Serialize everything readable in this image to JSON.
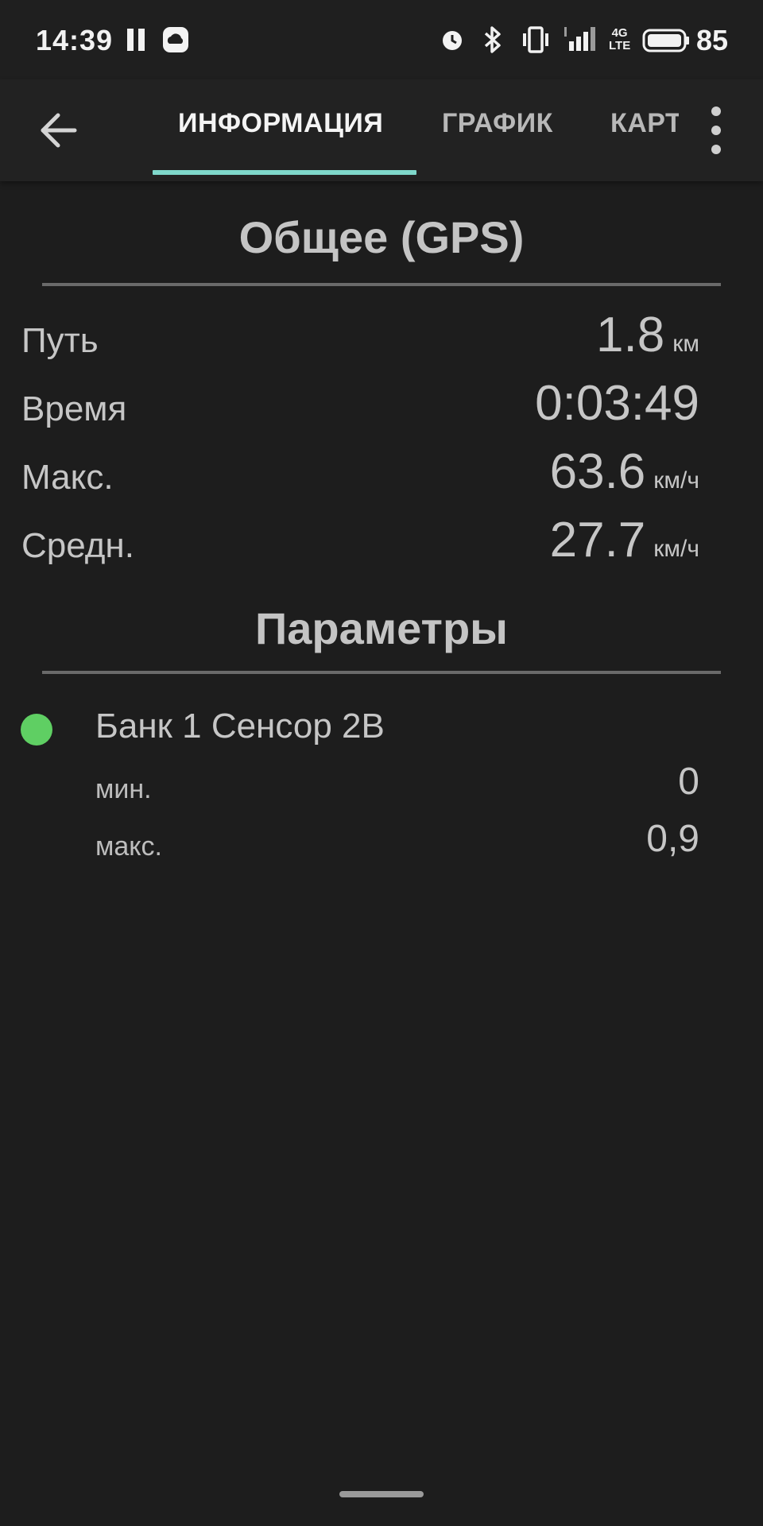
{
  "status_bar": {
    "time": "14:39",
    "network_label_top": "4G",
    "network_label_bottom": "LTE",
    "battery_level": "85",
    "icons": [
      "pause-icon",
      "cloud-app-icon",
      "alarm-icon",
      "bluetooth-icon",
      "vibrate-icon",
      "signal-icon",
      "network-4g-lte-icon",
      "battery-icon"
    ]
  },
  "toolbar": {
    "back_icon": "arrow-left-icon",
    "tabs": [
      {
        "label": "ИНФОРМАЦИЯ",
        "active": true
      },
      {
        "label": "ГРАФИК",
        "active": false
      },
      {
        "label": "КАРТА",
        "active": false
      }
    ],
    "overflow_icon": "more-vert-icon",
    "accent_color": "#7fd8cb"
  },
  "summary": {
    "title": "Общее (GPS)",
    "rows": [
      {
        "label": "Путь",
        "value": "1.8",
        "unit": "км"
      },
      {
        "label": "Время",
        "value": "0:03:49",
        "unit": ""
      },
      {
        "label": "Макс.",
        "value": "63.6",
        "unit": "км/ч"
      },
      {
        "label": "Средн.",
        "value": "27.7",
        "unit": "км/ч"
      }
    ]
  },
  "parameters": {
    "title": "Параметры",
    "items": [
      {
        "name": "Банк 1 Сенсор 2В",
        "color": "#5fcf63",
        "min_label": "мин.",
        "min_value": "0",
        "max_label": "макс.",
        "max_value": "0,9"
      }
    ]
  }
}
